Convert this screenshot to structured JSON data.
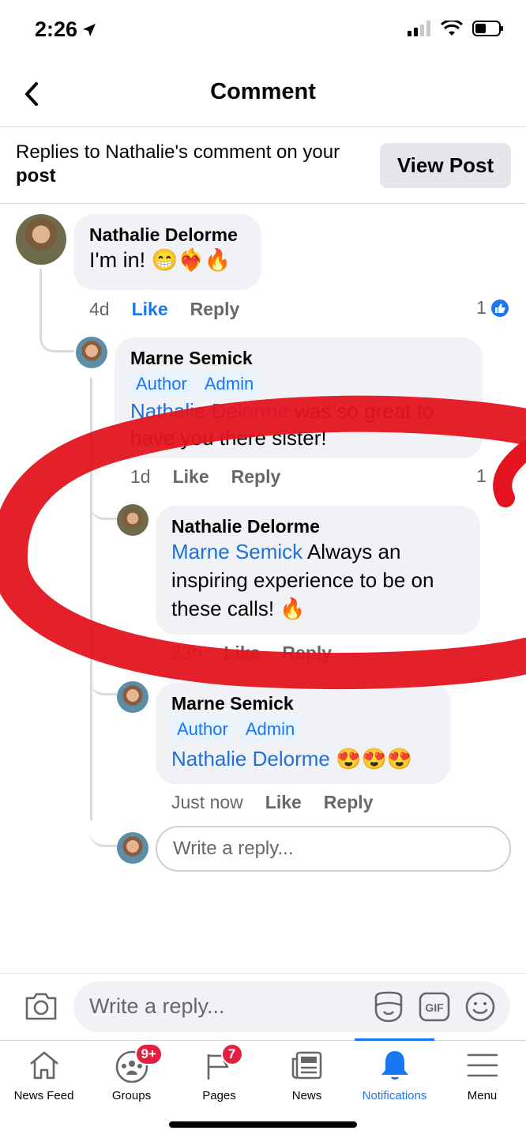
{
  "status": {
    "time": "2:26"
  },
  "header": {
    "title": "Comment",
    "replies_prefix": "Replies to Nathalie's comment on your",
    "replies_suffix": "post",
    "view_post": "View Post"
  },
  "comments": [
    {
      "author": "Nathalie Delorme",
      "text": "I'm in! 😁❤️‍🔥🔥",
      "time": "4d",
      "like": "Like",
      "reply": "Reply",
      "reactions": "1"
    },
    {
      "author": "Marne Semick",
      "tags": [
        "Author",
        "Admin"
      ],
      "mention": "Nathalie Delorme",
      "text": " was so great to have you there sister!",
      "time": "1d",
      "like": "Like",
      "reply": "Reply",
      "reactions": "1"
    },
    {
      "author": "Nathalie Delorme",
      "mention": "Marne Semick",
      "text": " Always an inspiring experience to be on these calls! 🔥",
      "time": "23h",
      "like": "Like",
      "reply": "Reply"
    },
    {
      "author": "Marne Semick",
      "tags": [
        "Author",
        "Admin"
      ],
      "mention": "Nathalie Delorme",
      "text": " 😍😍😍",
      "time": "Just now",
      "like": "Like",
      "reply": "Reply"
    }
  ],
  "thread_reply_placeholder": "Write a reply...",
  "composer": {
    "placeholder": "Write a reply...",
    "gif": "GIF"
  },
  "tabs": [
    {
      "label": "News Feed",
      "icon": "home-icon"
    },
    {
      "label": "Groups",
      "icon": "groups-icon",
      "badge": "9+"
    },
    {
      "label": "Pages",
      "icon": "flag-icon",
      "badge": "7"
    },
    {
      "label": "News",
      "icon": "newspaper-icon"
    },
    {
      "label": "Notifications",
      "icon": "bell-icon",
      "active": true
    },
    {
      "label": "Menu",
      "icon": "hamburger-icon"
    }
  ],
  "colors": {
    "accent": "#1877f2",
    "annotation": "#e3141f",
    "badge": "#e41e3f"
  }
}
